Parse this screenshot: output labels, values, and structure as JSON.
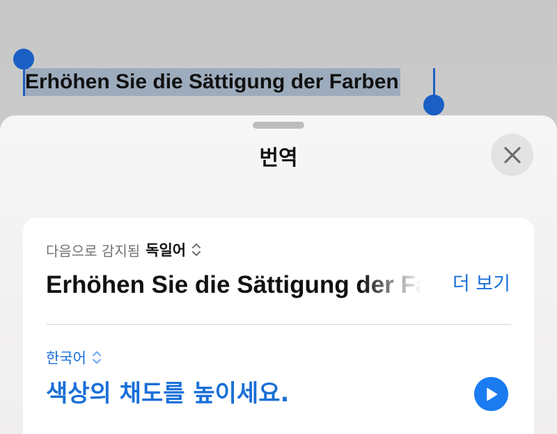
{
  "background": {
    "selected_text": "Erhöhen Sie die Sättigung der Farben"
  },
  "sheet": {
    "title": "번역",
    "close_icon": "close-icon",
    "source": {
      "detected_prefix": "다음으로 감지됨",
      "detected_language": "독일어",
      "text": "Erhöhen Sie die Sättigung der Farben",
      "more_label": "더 보기"
    },
    "target": {
      "language": "한국어",
      "text": "색상의 채도를 높이세요.",
      "play_icon": "play-icon"
    }
  },
  "colors": {
    "accent": "#1a6fd8",
    "selection_handle": "#1a5fc4",
    "selection_highlight": "#7894b2"
  }
}
